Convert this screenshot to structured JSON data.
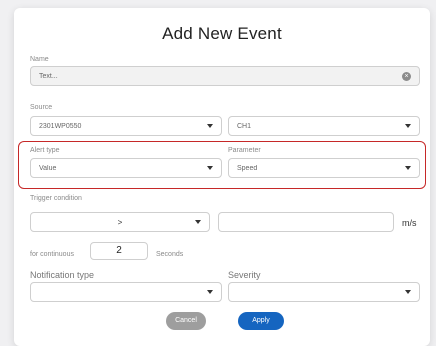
{
  "dialog": {
    "title": "Add New Event",
    "name": {
      "label": "Name",
      "placeholder": "Text..."
    },
    "source": {
      "label": "Source",
      "device_value": "2301WP0550",
      "channel_value": "CH1"
    },
    "alert_type": {
      "label": "Alert type",
      "value": "Value"
    },
    "parameter": {
      "label": "Parameter",
      "value": "Speed"
    },
    "trigger_condition": {
      "label": "Trigger condition",
      "operator_value": ">",
      "threshold_value": "",
      "unit": "m/s"
    },
    "continuous": {
      "prefix": "for continuous",
      "value": "2",
      "suffix": "Seconds"
    },
    "notification_type": {
      "label": "Notification type",
      "value": ""
    },
    "severity": {
      "label": "Severity",
      "value": ""
    },
    "buttons": {
      "cancel": "Cancel",
      "apply": "Apply"
    },
    "colors": {
      "highlight_border": "#c62828",
      "apply_button": "#1565c0",
      "cancel_button": "#9e9e9e"
    }
  }
}
